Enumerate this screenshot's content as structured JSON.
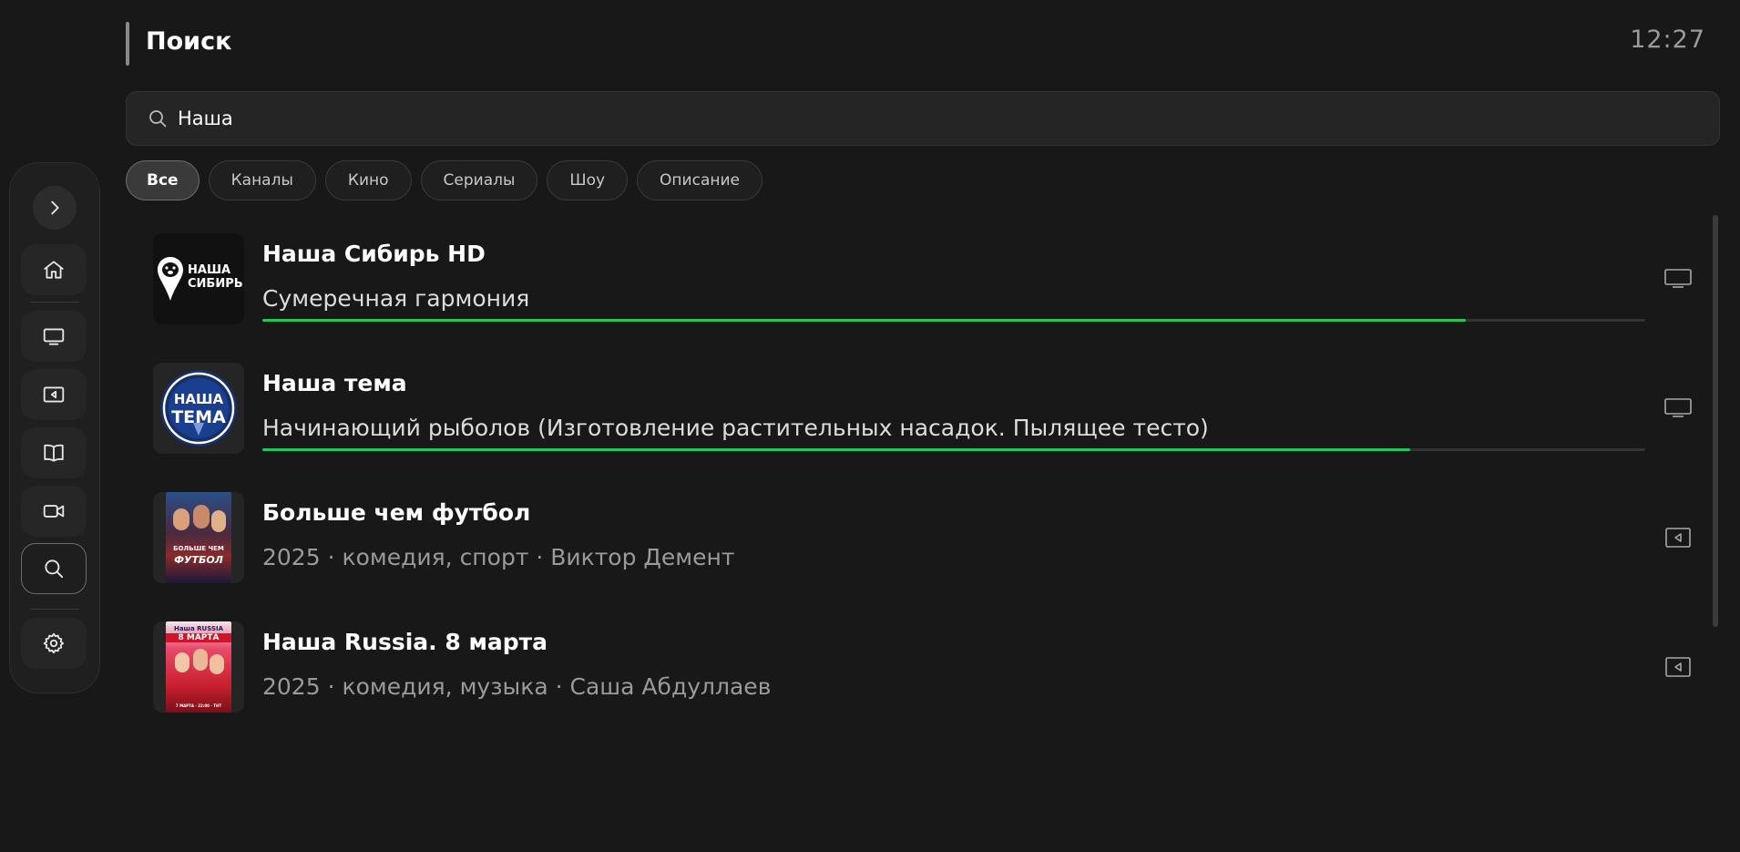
{
  "header": {
    "title": "Поиск",
    "clock": "12:27"
  },
  "search": {
    "value": "Наша",
    "placeholder": ""
  },
  "filters": [
    {
      "label": "Все",
      "active": true
    },
    {
      "label": "Каналы",
      "active": false
    },
    {
      "label": "Кино",
      "active": false
    },
    {
      "label": "Сериалы",
      "active": false
    },
    {
      "label": "Шоу",
      "active": false
    },
    {
      "label": "Описание",
      "active": false
    }
  ],
  "sidebar": {
    "items": [
      {
        "icon": "chevron-right-icon"
      },
      {
        "icon": "home-icon"
      },
      {
        "icon": "tv-icon"
      },
      {
        "icon": "movie-icon"
      },
      {
        "icon": "book-icon"
      },
      {
        "icon": "video-camera-icon"
      },
      {
        "icon": "search-icon",
        "active": true
      },
      {
        "icon": "gear-icon"
      }
    ]
  },
  "results": [
    {
      "title": "Наша Сибирь HD",
      "subtitle": "Сумеречная гармония",
      "kind": "channel",
      "progress": 0.87,
      "logo_text": [
        "НАША",
        "СИБИРЬ"
      ]
    },
    {
      "title": "Наша тема",
      "subtitle": "Начинающий рыболов (Изготовление растительных насадок. Пылящее тесто)",
      "kind": "channel",
      "progress": 0.83,
      "logo_text": [
        "НАША",
        "ТЕМА"
      ]
    },
    {
      "title": "Больше чем футбол",
      "subtitle": "2025 · комедия, спорт · Виктор Демент",
      "kind": "movie",
      "poster_text": [
        "БОЛЬШЕ ЧЕМ",
        "ФУТБОЛ"
      ]
    },
    {
      "title": "Наша Russia. 8 марта",
      "subtitle": "2025 · комедия, музыка · Саша Абдуллаев",
      "kind": "movie",
      "poster_text": [
        "Наша RUSSIA",
        "8 МАРТА",
        "7 МАРТА · 22:00 · ТНТ"
      ]
    }
  ],
  "colors": {
    "background": "#181818",
    "progress": "#22c55e",
    "accent_blue": "#1e3a8a"
  }
}
